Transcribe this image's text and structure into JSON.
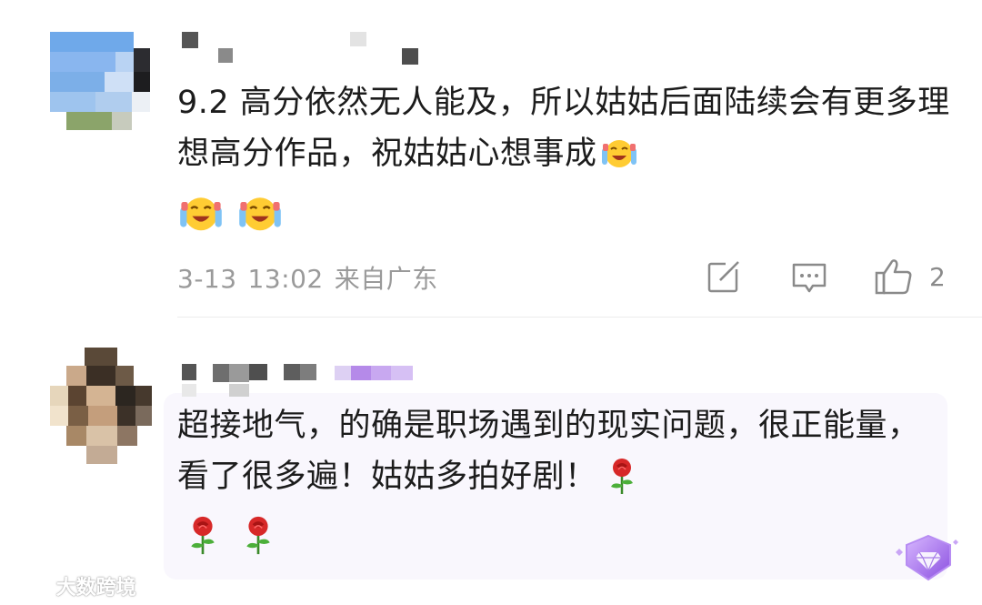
{
  "comments": [
    {
      "text": "9.2 高分依然无人能及，所以姑姑后面陆续会有更多理想高分作品，祝姑姑心想事成",
      "trailing_emojis": [
        "laughing-cry-emoji",
        "laughing-cry-emoji",
        "laughing-cry-emoji"
      ],
      "date": "3-13",
      "time": "13:02",
      "location": "来自广东",
      "like_count": "2",
      "actions": [
        "share-icon",
        "comment-icon",
        "thumbs-up-icon"
      ]
    },
    {
      "text": "超接地气，的确是职场遇到的现实问题，很正能量，看了很多遍！姑姑多拍好剧！",
      "trailing_emojis": [
        "rose-emoji",
        "rose-emoji",
        "rose-emoji"
      ],
      "badge": "diamond-badge-icon"
    }
  ],
  "watermark": "大数跨境",
  "colors": {
    "meta_text": "#9a9a9a",
    "bubble_bg": "#f9f7fd",
    "name_highlight": "#c8a8f0"
  }
}
